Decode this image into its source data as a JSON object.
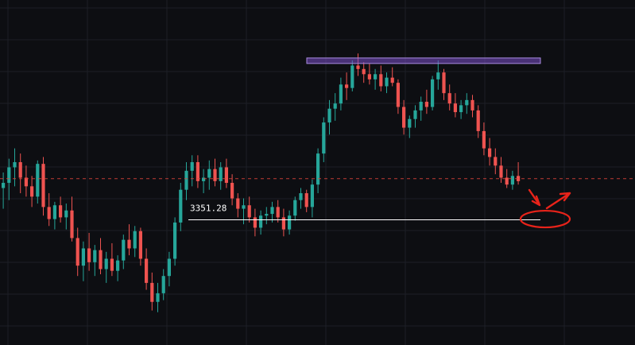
{
  "theme": {
    "background": "#0d0e12",
    "grid": "#1d1f26",
    "up_color": "#26a69a",
    "down_color": "#ef5350",
    "resistance_fill": "#7b4fc9",
    "resistance_stroke": "#a98be0",
    "support_line": "#ffffff",
    "dashed_line": "#e0443a",
    "annotation": "#e8231a"
  },
  "chart_data": {
    "type": "candlestick",
    "title": "",
    "xlabel": "",
    "ylabel": "",
    "ylim": [
      3315,
      3415
    ],
    "grid": true,
    "annotations": {
      "support_level": {
        "value": 3351.28,
        "label": "3351.28"
      },
      "current_price_dashed": 3363.2,
      "resistance_zone": [
        3398.2,
        3396.6
      ]
    },
    "candles": [
      [
        3360.5,
        3365.0,
        3354.5,
        3362.0
      ],
      [
        3362.0,
        3369.0,
        3357.0,
        3366.5
      ],
      [
        3366.5,
        3372.0,
        3361.0,
        3368.0
      ],
      [
        3368.0,
        3370.5,
        3359.0,
        3363.5
      ],
      [
        3363.5,
        3367.0,
        3358.0,
        3361.0
      ],
      [
        3361.0,
        3364.0,
        3355.0,
        3358.0
      ],
      [
        3358.0,
        3368.5,
        3356.0,
        3367.5
      ],
      [
        3367.5,
        3369.5,
        3352.5,
        3355.0
      ],
      [
        3355.0,
        3359.0,
        3349.5,
        3351.5
      ],
      [
        3351.5,
        3356.5,
        3348.5,
        3355.5
      ],
      [
        3355.5,
        3358.0,
        3350.5,
        3352.0
      ],
      [
        3352.0,
        3356.0,
        3348.5,
        3354.0
      ],
      [
        3354.0,
        3358.0,
        3345.0,
        3346.0
      ],
      [
        3346.0,
        3349.0,
        3335.0,
        3338.0
      ],
      [
        3338.0,
        3345.0,
        3333.5,
        3343.0
      ],
      [
        3343.0,
        3347.5,
        3336.5,
        3339.0
      ],
      [
        3339.0,
        3344.0,
        3335.0,
        3342.5
      ],
      [
        3342.5,
        3346.0,
        3335.5,
        3337.0
      ],
      [
        3337.0,
        3342.0,
        3333.0,
        3340.0
      ],
      [
        3340.0,
        3344.5,
        3335.0,
        3336.5
      ],
      [
        3336.5,
        3341.0,
        3333.5,
        3339.5
      ],
      [
        3339.5,
        3347.0,
        3337.0,
        3345.5
      ],
      [
        3345.5,
        3350.0,
        3341.0,
        3343.0
      ],
      [
        3343.0,
        3349.5,
        3340.5,
        3348.0
      ],
      [
        3348.0,
        3349.0,
        3338.0,
        3340.0
      ],
      [
        3340.0,
        3343.0,
        3331.0,
        3333.0
      ],
      [
        3333.0,
        3336.0,
        3325.0,
        3327.5
      ],
      [
        3327.5,
        3333.0,
        3324.5,
        3330.0
      ],
      [
        3330.0,
        3337.0,
        3328.0,
        3335.0
      ],
      [
        3335.0,
        3342.0,
        3332.0,
        3340.0
      ],
      [
        3340.0,
        3352.0,
        3338.0,
        3350.5
      ],
      [
        3350.5,
        3362.0,
        3348.0,
        3360.0
      ],
      [
        3360.0,
        3368.0,
        3357.0,
        3365.5
      ],
      [
        3365.5,
        3370.0,
        3361.0,
        3368.0
      ],
      [
        3368.0,
        3370.0,
        3360.5,
        3362.5
      ],
      [
        3362.5,
        3366.0,
        3359.0,
        3363.5
      ],
      [
        3363.5,
        3368.5,
        3360.0,
        3366.0
      ],
      [
        3366.0,
        3369.0,
        3361.0,
        3362.5
      ],
      [
        3362.5,
        3368.0,
        3360.0,
        3366.5
      ],
      [
        3366.5,
        3369.0,
        3360.5,
        3362.0
      ],
      [
        3362.0,
        3364.5,
        3355.5,
        3357.5
      ],
      [
        3357.5,
        3359.0,
        3352.0,
        3354.5
      ],
      [
        3354.5,
        3357.5,
        3350.0,
        3355.5
      ],
      [
        3355.5,
        3358.0,
        3350.5,
        3352.0
      ],
      [
        3352.0,
        3354.5,
        3346.5,
        3349.0
      ],
      [
        3349.0,
        3354.0,
        3347.0,
        3352.5
      ],
      [
        3352.5,
        3355.0,
        3350.0,
        3353.0
      ],
      [
        3353.0,
        3356.5,
        3350.5,
        3355.0
      ],
      [
        3355.0,
        3357.0,
        3350.5,
        3352.0
      ],
      [
        3352.0,
        3354.5,
        3346.5,
        3348.5
      ],
      [
        3348.5,
        3354.0,
        3347.0,
        3352.5
      ],
      [
        3352.5,
        3358.0,
        3351.0,
        3357.0
      ],
      [
        3357.0,
        3360.5,
        3354.5,
        3359.0
      ],
      [
        3359.0,
        3360.0,
        3353.5,
        3355.0
      ],
      [
        3355.0,
        3363.0,
        3352.0,
        3361.5
      ],
      [
        3361.5,
        3372.0,
        3359.0,
        3370.5
      ],
      [
        3370.5,
        3381.0,
        3368.0,
        3379.5
      ],
      [
        3379.5,
        3386.0,
        3376.0,
        3383.5
      ],
      [
        3383.5,
        3388.0,
        3380.0,
        3385.0
      ],
      [
        3385.0,
        3392.5,
        3383.0,
        3390.5
      ],
      [
        3390.5,
        3394.0,
        3386.0,
        3389.5
      ],
      [
        3389.5,
        3397.5,
        3388.5,
        3396.0
      ],
      [
        3396.0,
        3399.5,
        3393.0,
        3395.0
      ],
      [
        3395.0,
        3397.0,
        3391.0,
        3393.5
      ],
      [
        3393.5,
        3396.5,
        3390.5,
        3392.0
      ],
      [
        3392.0,
        3395.0,
        3389.0,
        3393.5
      ],
      [
        3393.5,
        3396.0,
        3388.5,
        3390.0
      ],
      [
        3390.0,
        3394.0,
        3388.0,
        3392.5
      ],
      [
        3392.5,
        3395.5,
        3390.0,
        3391.0
      ],
      [
        3391.0,
        3392.0,
        3382.0,
        3384.0
      ],
      [
        3384.0,
        3386.0,
        3376.0,
        3378.0
      ],
      [
        3378.0,
        3381.5,
        3375.0,
        3380.5
      ],
      [
        3380.5,
        3384.5,
        3378.0,
        3383.0
      ],
      [
        3383.0,
        3387.0,
        3380.0,
        3385.5
      ],
      [
        3385.5,
        3389.0,
        3382.0,
        3384.0
      ],
      [
        3384.0,
        3393.0,
        3383.0,
        3392.0
      ],
      [
        3392.0,
        3397.5,
        3389.0,
        3394.0
      ],
      [
        3394.0,
        3395.0,
        3386.0,
        3388.0
      ],
      [
        3388.0,
        3390.5,
        3383.0,
        3385.0
      ],
      [
        3385.0,
        3388.0,
        3381.0,
        3382.5
      ],
      [
        3382.5,
        3386.0,
        3380.5,
        3384.5
      ],
      [
        3384.5,
        3388.0,
        3382.0,
        3386.0
      ],
      [
        3386.0,
        3387.5,
        3381.0,
        3383.0
      ],
      [
        3383.0,
        3384.5,
        3375.0,
        3377.0
      ],
      [
        3377.0,
        3379.5,
        3370.0,
        3372.0
      ],
      [
        3372.0,
        3375.0,
        3367.0,
        3369.5
      ],
      [
        3369.5,
        3372.0,
        3364.5,
        3367.0
      ],
      [
        3367.0,
        3369.5,
        3362.0,
        3363.5
      ],
      [
        3363.5,
        3366.0,
        3360.5,
        3361.5
      ],
      [
        3361.5,
        3365.5,
        3360.0,
        3364.0
      ],
      [
        3364.0,
        3368.0,
        3361.5,
        3362.5
      ]
    ]
  }
}
